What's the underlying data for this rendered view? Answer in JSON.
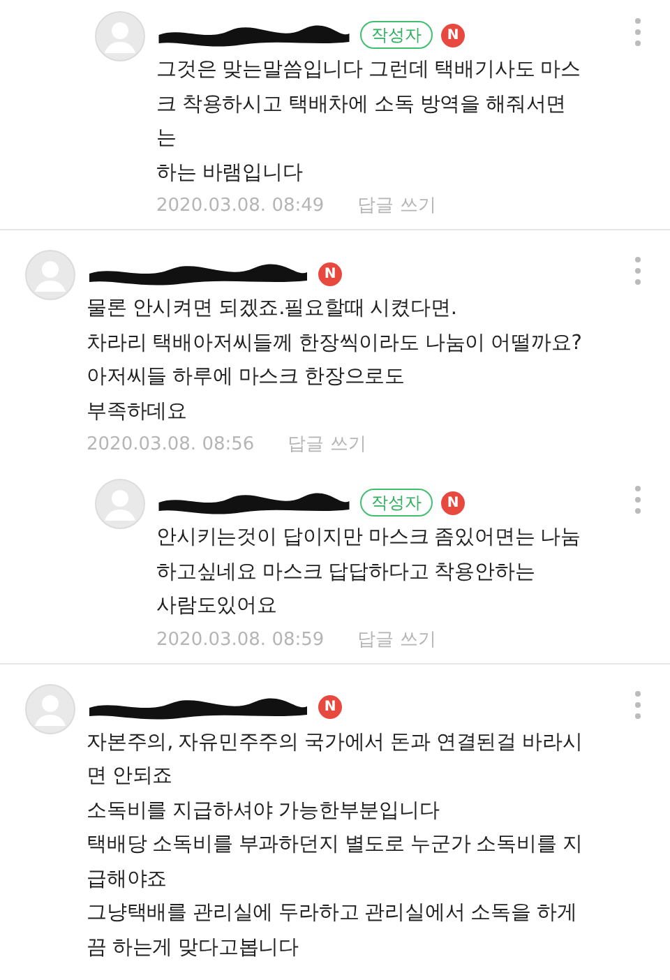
{
  "comments": [
    {
      "is_reply": true,
      "author_badge": "작성자",
      "new_mark": "N",
      "body": "그것은 맞는말씀입니다 그런데 택배기사도 마스\n크 착용하시고 택배차에 소독 방역을 해줘서면\n는\n하는 바램입니다",
      "date": "2020.03.08. 08:49",
      "reply_link": "답글 쓰기"
    },
    {
      "is_reply": false,
      "new_mark": "N",
      "body": "물론 안시켜면 되겠죠.필요할때 시켰다면.\n차라리 택배아저씨들께 한장씩이라도 나눔이 어떨까요?\n아저씨들 하루에 마스크 한장으로도\n부족하데요",
      "date": "2020.03.08. 08:56",
      "reply_link": "답글 쓰기"
    },
    {
      "is_reply": true,
      "author_badge": "작성자",
      "new_mark": "N",
      "body": "안시키는것이 답이지만 마스크 좀있어면는 나눔\n하고싶네요 마스크 답답하다고 착용안하는\n사람도있어요",
      "date": "2020.03.08. 08:59",
      "reply_link": "답글 쓰기"
    },
    {
      "is_reply": false,
      "new_mark": "N",
      "body": "자본주의, 자유민주주의 국가에서 돈과 연결된걸 바라시\n면 안되죠\n소독비를 지급하셔야 가능한부분입니다\n택배당 소독비를 부과하던지 별도로 누군가 소독비를 지\n급해야죠\n그냥택배를 관리실에 두라하고 관리실에서 소독을 하게\n끔 하는게 맞다고봅니다"
    }
  ]
}
